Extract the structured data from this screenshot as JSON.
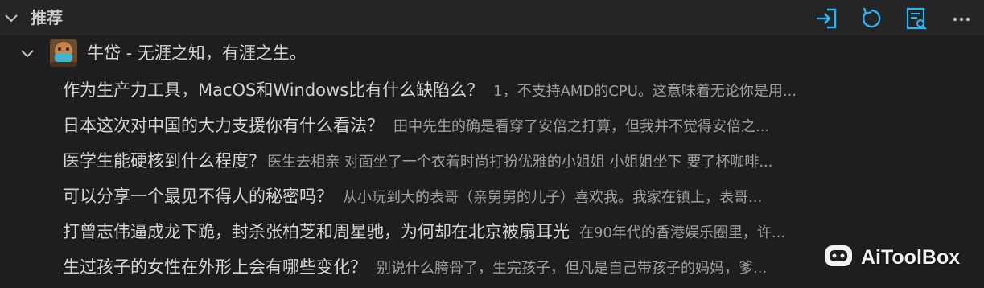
{
  "section": {
    "title": "推荐",
    "tools": [
      {
        "name": "sign-in-icon",
        "label": "Sign in"
      },
      {
        "name": "refresh-icon",
        "label": "Refresh"
      },
      {
        "name": "search-list-icon",
        "label": "Search"
      },
      {
        "name": "more-icon",
        "label": "More"
      }
    ],
    "accent": "#29b6f6"
  },
  "user": {
    "name": "牛岱 - 无涯之知，有涯之生。"
  },
  "items": [
    {
      "question": "作为生产力工具，MacOS和Windows比有什么缺陷么？",
      "answer": "1，不支持AMD的CPU。这意味着无论你是用..."
    },
    {
      "question": "日本这次对中国的大力支援你有什么看法？",
      "answer": "田中先生的确是看穿了安倍之打算，但我并不觉得安倍之..."
    },
    {
      "question": "医学生能硬核到什么程度?",
      "answer": "医生去相亲 对面坐了一个衣着时尚打扮优雅的小姐姐 小姐姐坐下 要了杯咖啡..."
    },
    {
      "question": "可以分享一个最见不得人的秘密吗？",
      "answer": "从小玩到大的表哥（亲舅舅的儿子）喜欢我。我家在镇上，表哥..."
    },
    {
      "question": "打曾志伟逼成龙下跪，封杀张柏芝和周星驰，为何却在北京被扇耳光",
      "answer": "在90年代的香港娱乐圈里，许..."
    },
    {
      "question": "生过孩子的女性在外形上会有哪些变化？",
      "answer": "别说什么胯骨了，生完孩子，但凡是自己带孩子的妈妈，爹..."
    }
  ],
  "watermark": {
    "text": "AiToolBox"
  }
}
